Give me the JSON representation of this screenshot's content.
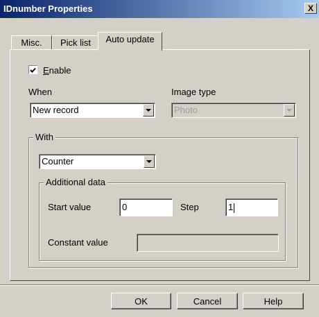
{
  "window": {
    "title": "IDnumber Properties",
    "close_glyph": "X"
  },
  "tabs": [
    {
      "label": "Misc.",
      "active": false
    },
    {
      "label": "Pick list",
      "active": false
    },
    {
      "label": "Auto update",
      "active": true
    }
  ],
  "enable": {
    "label_mnemonic": "E",
    "label_rest": "nable",
    "checked": true
  },
  "when": {
    "label": "When",
    "value": "New record"
  },
  "image_type": {
    "label": "Image type",
    "value": "Photo",
    "disabled": true
  },
  "with": {
    "label": "With",
    "value": "Counter"
  },
  "additional": {
    "label": "Additional data",
    "start_label": "Start value",
    "start_value": "0",
    "step_label": "Step",
    "step_value": "1",
    "constant_label": "Constant value",
    "constant_value": ""
  },
  "buttons": {
    "ok": "OK",
    "cancel": "Cancel",
    "help": "Help"
  }
}
